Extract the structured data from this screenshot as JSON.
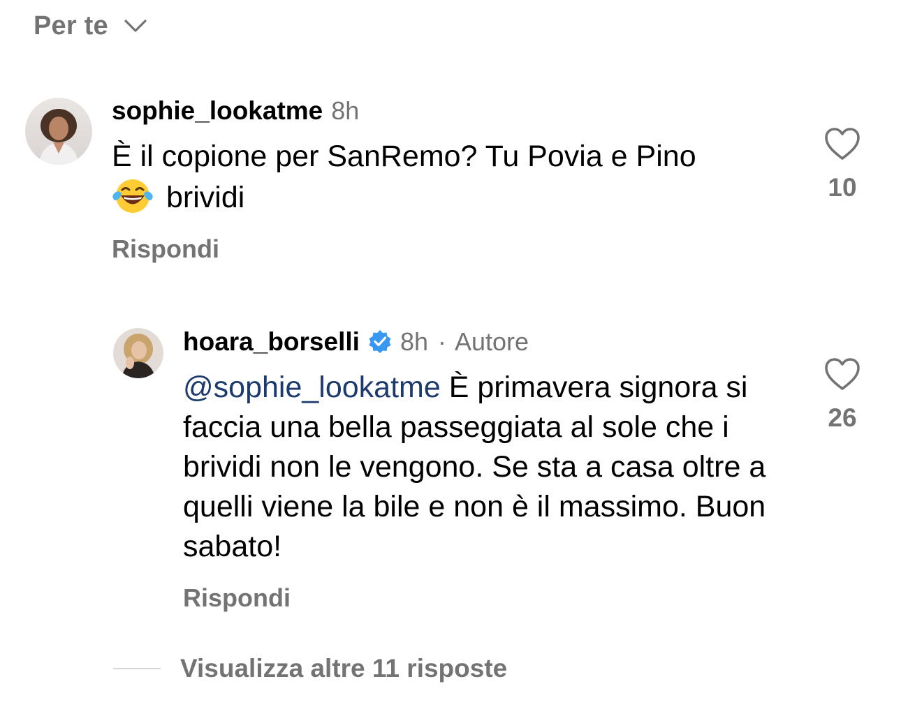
{
  "filter": {
    "label": "Per te",
    "icon": "chevron-down-icon"
  },
  "comments": [
    {
      "username": "sophie_lookatme",
      "time": "8h",
      "text_line1": "È il copione per SanRemo? Tu Povia e Pino",
      "emoji": "😂",
      "text_line2": "brividi",
      "reply_label": "Rispondi",
      "likes": "10",
      "avatar_icon": "avatar-sophie"
    },
    {
      "username": "hoara_borselli",
      "verified": true,
      "time": "8h",
      "separator": "·",
      "author_label": "Autore",
      "mention": "@sophie_lookatme",
      "text": " È primavera signora si faccia una bella passeggiata al sole che i brividi non le vengono. Se sta a casa oltre a quelli viene la bile e non è il massimo. Buon sabato!",
      "reply_label": "Rispondi",
      "likes": "26",
      "avatar_icon": "avatar-hoara"
    }
  ],
  "more_replies": {
    "label": "Visualizza altre 11 risposte"
  },
  "colors": {
    "secondary_text": "#737373",
    "mention": "#1c3a6e",
    "verified_badge": "#3897f0"
  }
}
